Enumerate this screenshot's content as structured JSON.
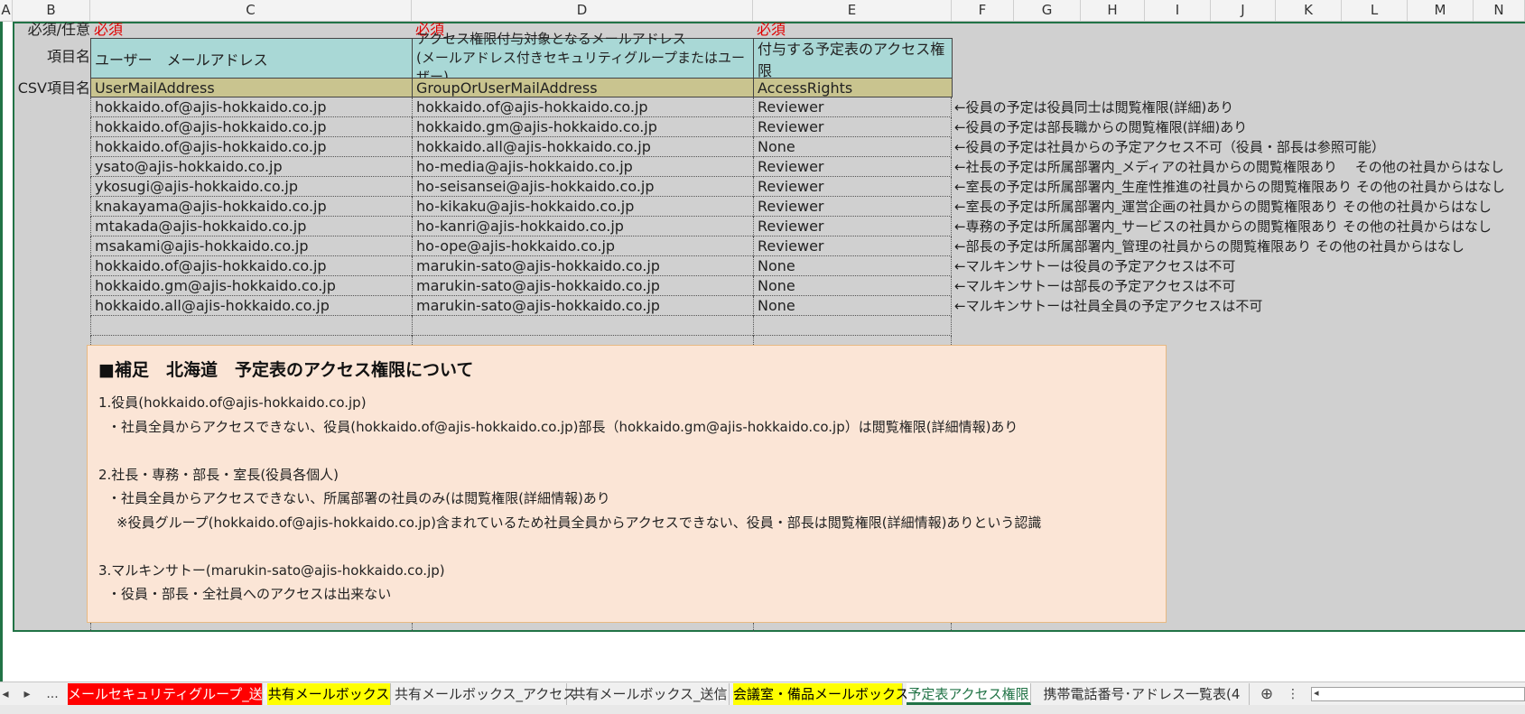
{
  "columns": [
    "A",
    "B",
    "C",
    "D",
    "E",
    "F",
    "G",
    "H",
    "I",
    "J",
    "K",
    "L",
    "M",
    "N"
  ],
  "labels": {
    "required_or_optional": "必須/任意",
    "item_name": "項目名",
    "csv_item_name": "CSV項目名"
  },
  "required_marks": {
    "c": "必須",
    "d": "必須",
    "e": "必須"
  },
  "headers": {
    "c": "ユーザー　メールアドレス",
    "d_line1": "アクセス権限付与対象となるメールアドレス",
    "d_line2": "(メールアドレス付きセキュリティグループまたはユーザー)",
    "e": "付与する予定表のアクセス権限"
  },
  "csv_headers": {
    "c": "UserMailAddress",
    "d": "GroupOrUserMailAddress",
    "e": "AccessRights"
  },
  "rows": [
    {
      "user": "hokkaido.of@ajis-hokkaido.co.jp",
      "target": "hokkaido.of@ajis-hokkaido.co.jp",
      "rights": "Reviewer",
      "note": "←役員の予定は役員同士は閲覧権限(詳細)あり"
    },
    {
      "user": "hokkaido.of@ajis-hokkaido.co.jp",
      "target": "hokkaido.gm@ajis-hokkaido.co.jp",
      "rights": "Reviewer",
      "note": "←役員の予定は部長職からの閲覧権限(詳細)あり"
    },
    {
      "user": "hokkaido.of@ajis-hokkaido.co.jp",
      "target": "hokkaido.all@ajis-hokkaido.co.jp",
      "rights": "None",
      "note": "←役員の予定は社員からの予定アクセス不可（役員・部長は参照可能）"
    },
    {
      "user": "ysato@ajis-hokkaido.co.jp",
      "target": "ho-media@ajis-hokkaido.co.jp",
      "rights": "Reviewer",
      "note": "←社長の予定は所属部署内_メディアの社員からの閲覧権限あり　 その他の社員からはなし"
    },
    {
      "user": "ykosugi@ajis-hokkaido.co.jp",
      "target": "ho-seisansei@ajis-hokkaido.co.jp",
      "rights": "Reviewer",
      "note": "←室長の予定は所属部署内_生産性推進の社員からの閲覧権限あり  その他の社員からはなし"
    },
    {
      "user": "knakayama@ajis-hokkaido.co.jp",
      "target": "ho-kikaku@ajis-hokkaido.co.jp",
      "rights": "Reviewer",
      "note": "←室長の予定は所属部署内_運営企画の社員からの閲覧権限あり  その他の社員からはなし"
    },
    {
      "user": "mtakada@ajis-hokkaido.co.jp",
      "target": "ho-kanri@ajis-hokkaido.co.jp",
      "rights": "Reviewer",
      "note": "←専務の予定は所属部署内_サービスの社員からの閲覧権限あり  その他の社員からはなし"
    },
    {
      "user": "msakami@ajis-hokkaido.co.jp",
      "target": "ho-ope@ajis-hokkaido.co.jp",
      "rights": "Reviewer",
      "note": "←部長の予定は所属部署内_管理の社員からの閲覧権限あり  その他の社員からはなし"
    },
    {
      "user": "hokkaido.of@ajis-hokkaido.co.jp",
      "target": "marukin-sato@ajis-hokkaido.co.jp",
      "rights": "None",
      "note": "←マルキンサトーは役員の予定アクセスは不可"
    },
    {
      "user": "hokkaido.gm@ajis-hokkaido.co.jp",
      "target": "marukin-sato@ajis-hokkaido.co.jp",
      "rights": "None",
      "note": "←マルキンサトーは部長の予定アクセスは不可"
    },
    {
      "user": "hokkaido.all@ajis-hokkaido.co.jp",
      "target": "marukin-sato@ajis-hokkaido.co.jp",
      "rights": "None",
      "note": "←マルキンサトーは社員全員の予定アクセスは不可"
    }
  ],
  "memo": {
    "title": "■補足　北海道　予定表のアクセス権限について",
    "lines": [
      "1.役員(hokkaido.of@ajis-hokkaido.co.jp)",
      "・社員全員からアクセスできない、役員(hokkaido.of@ajis-hokkaido.co.jp)部長（hokkaido.gm@ajis-hokkaido.co.jp）は閲覧権限(詳細情報)あり",
      "2.社長・専務・部長・室長(役員各個人)",
      "・社員全員からアクセスできない、所属部署の社員のみ(は閲覧権限(詳細情報)あり",
      "※役員グループ(hokkaido.of@ajis-hokkaido.co.jp)含まれているため社員全員からアクセスできない、役員・部長は閲覧権限(詳細情報)ありという認識",
      "3.マルキンサトー(marukin-sato@ajis-hokkaido.co.jp)",
      "・役員・部長・全社員へのアクセスは出来ない"
    ]
  },
  "tabs": [
    {
      "label": "メールセキュリティグループ_送信",
      "bg": "#ff0000",
      "fg": "#ffffff"
    },
    {
      "label": "共有メールボックス",
      "bg": "#ffff00",
      "fg": "#000000"
    },
    {
      "label": "共有メールボックス_アクセス",
      "bg": "#f0f0f0",
      "fg": "#333333"
    },
    {
      "label": "共有メールボックス_送信",
      "bg": "#f0f0f0",
      "fg": "#333333"
    },
    {
      "label": "会議室・備品メールボックス",
      "bg": "#ffff00",
      "fg": "#000000"
    },
    {
      "label": "予定表アクセス権限",
      "bg": "#ffffff",
      "fg": "#217346"
    },
    {
      "label": "携帯電話番号･アドレス一覧表(4",
      "bg": "#f0f0f0",
      "fg": "#333333"
    }
  ],
  "nav": {
    "prev": "◂",
    "next": "▸",
    "more": "...",
    "add": "⊕",
    "menu": "⋮",
    "scroll_left": "◂"
  },
  "colors": {
    "accent": "#217346",
    "header_fill": "#a9d8d6",
    "csv_fill": "#c9c48f",
    "memo_fill": "#fbe5d6",
    "required": "#e00000"
  }
}
